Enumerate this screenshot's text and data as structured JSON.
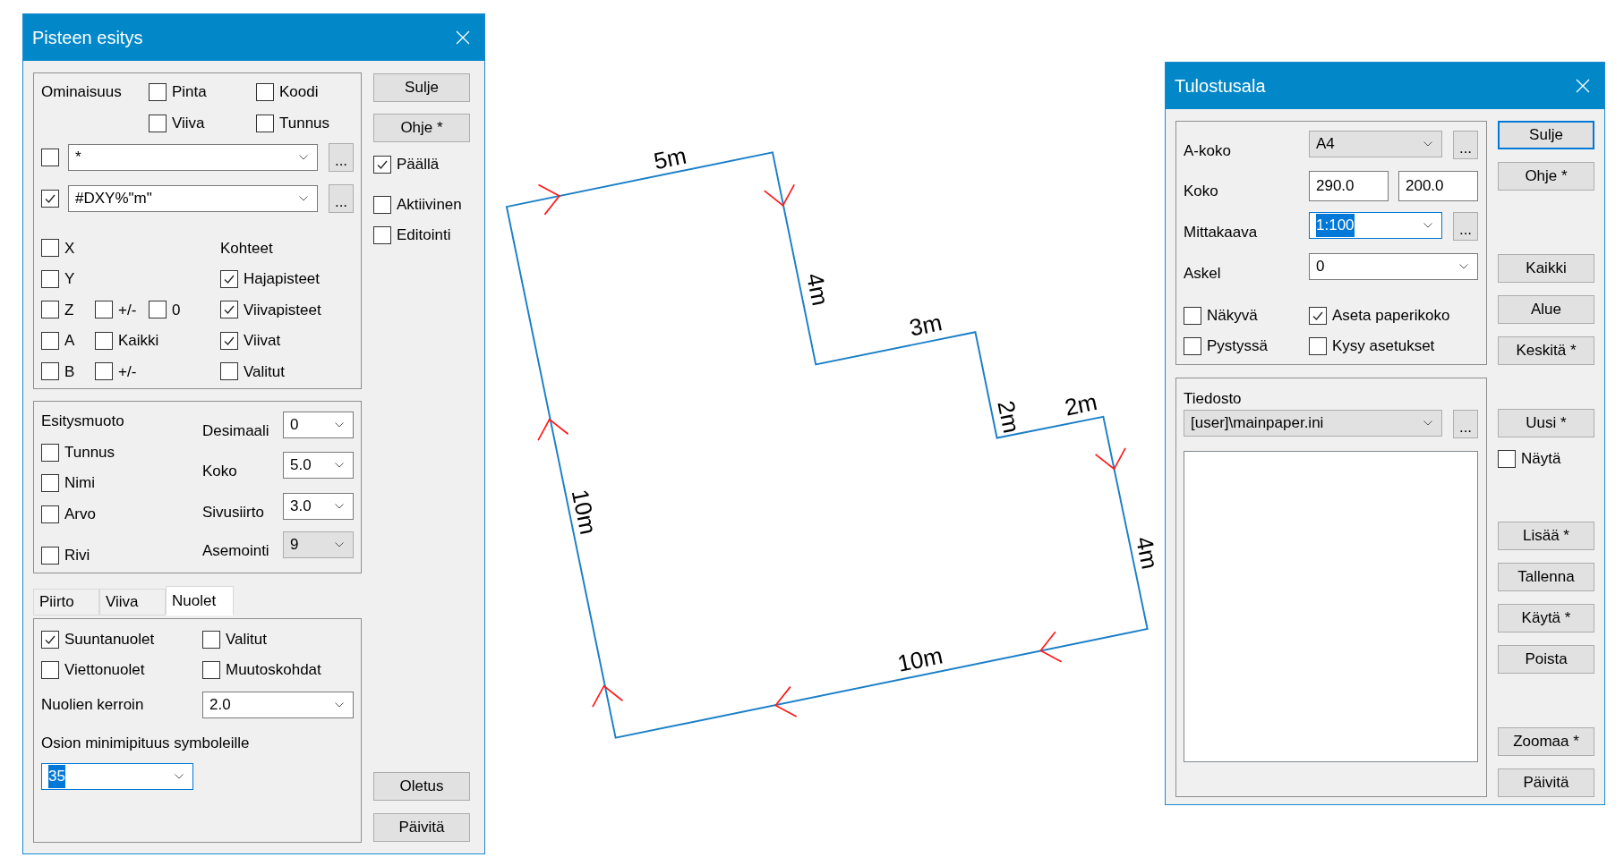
{
  "point_dialog": {
    "title": "Pisteen esitys",
    "properties_group": {
      "label": "Ominaisuus",
      "options": [
        {
          "label": "Pinta",
          "checked": false
        },
        {
          "label": "Koodi",
          "checked": false
        },
        {
          "label": "Viiva",
          "checked": false
        },
        {
          "label": "Tunnus",
          "checked": false
        }
      ],
      "filters": [
        {
          "checked": false,
          "value": "*",
          "browse": "..."
        },
        {
          "checked": true,
          "value": "#DXY%\"m\"",
          "browse": "..."
        }
      ],
      "coordinate_rows": [
        {
          "label": "X",
          "checked": false
        },
        {
          "label": "Y",
          "checked": false
        },
        {
          "label": "Z",
          "checked": false,
          "extras": [
            {
              "label": "+/-",
              "checked": false
            },
            {
              "label": "0",
              "checked": false
            }
          ]
        },
        {
          "label": "A",
          "checked": false,
          "extras": [
            {
              "label": "Kaikki",
              "checked": false
            }
          ]
        },
        {
          "label": "B",
          "checked": false,
          "extras": [
            {
              "label": "+/-",
              "checked": false
            }
          ]
        }
      ],
      "targets_label": "Kohteet",
      "targets": [
        {
          "label": "Hajapisteet",
          "checked": true
        },
        {
          "label": "Viivapisteet",
          "checked": true
        },
        {
          "label": "Viivat",
          "checked": true
        },
        {
          "label": "Valitut",
          "checked": false
        }
      ]
    },
    "format_group": {
      "label": "Esitysmuoto",
      "options": [
        {
          "label": "Tunnus",
          "checked": false
        },
        {
          "label": "Nimi",
          "checked": false
        },
        {
          "label": "Arvo",
          "checked": false
        },
        {
          "label": "Rivi",
          "checked": false
        }
      ],
      "fields": [
        {
          "label": "Desimaali",
          "value": "0",
          "disabled": false
        },
        {
          "label": "Koko",
          "value": "5.0",
          "disabled": false
        },
        {
          "label": "Sivusiirto",
          "value": "3.0",
          "disabled": false
        },
        {
          "label": "Asemointi",
          "value": "9",
          "disabled": true
        }
      ]
    },
    "tabs": [
      {
        "label": "Piirto",
        "selected": false
      },
      {
        "label": "Viiva",
        "selected": false
      },
      {
        "label": "Nuolet",
        "selected": true
      }
    ],
    "arrows_panel": {
      "options": [
        {
          "label": "Suuntanuolet",
          "checked": true
        },
        {
          "label": "Valitut",
          "checked": false
        },
        {
          "label": "Viettonuolet",
          "checked": false
        },
        {
          "label": "Muutoskohdat",
          "checked": false
        }
      ],
      "factor": {
        "label": "Nuolien kerroin",
        "value": "2.0",
        "text_selected": false
      },
      "min_length": {
        "label": "Osion minimipituus symboleille",
        "value": "35",
        "text_selected": true
      }
    },
    "side": [
      {
        "kind": "button",
        "label": "Sulje",
        "focused": false
      },
      {
        "kind": "button",
        "label": "Ohje *",
        "focused": false
      },
      {
        "kind": "checkbox",
        "label": "Päällä",
        "checked": true
      },
      {
        "kind": "checkbox",
        "label": "Aktiivinen",
        "checked": false
      },
      {
        "kind": "checkbox",
        "label": "Editointi",
        "checked": false
      },
      {
        "kind": "button",
        "label": "Oletus",
        "focused": false
      },
      {
        "kind": "button",
        "label": "Päivitä",
        "focused": false
      }
    ]
  },
  "drawing": {
    "edge_labels": [
      "5m",
      "4m",
      "3m",
      "2m",
      "2m",
      "4m",
      "10m",
      "10m"
    ]
  },
  "print_area_dialog": {
    "title": "Tulostusala",
    "fields": [
      {
        "kind": "combo",
        "label": "A-koko",
        "value": "A4",
        "disabled": true,
        "text_selected": false,
        "browse": "..."
      },
      {
        "kind": "pair",
        "label": "Koko",
        "values": [
          "290.0",
          "200.0"
        ]
      },
      {
        "kind": "combo",
        "label": "Mittakaava",
        "value": "1:100",
        "disabled": false,
        "text_selected": true,
        "browse": "..."
      },
      {
        "kind": "combo",
        "label": "Askel",
        "value": "0",
        "disabled": false,
        "text_selected": false
      }
    ],
    "options": [
      {
        "label": "Näkyvä",
        "checked": false
      },
      {
        "label": "Aseta paperikoko",
        "checked": true
      },
      {
        "label": "Pystyssä",
        "checked": false
      },
      {
        "label": "Kysy asetukset",
        "checked": false
      }
    ],
    "file_group": {
      "label": "Tiedosto",
      "value": "[user]\\mainpaper.ini",
      "disabled": true,
      "browse": "..."
    },
    "side": [
      {
        "kind": "button",
        "label": "Sulje",
        "focused": true
      },
      {
        "kind": "button",
        "label": "Ohje *",
        "focused": false
      },
      {
        "kind": "button",
        "label": "Kaikki",
        "focused": false
      },
      {
        "kind": "button",
        "label": "Alue",
        "focused": false
      },
      {
        "kind": "button",
        "label": "Keskitä *",
        "focused": false
      },
      {
        "kind": "button",
        "label": "Uusi *",
        "focused": false
      },
      {
        "kind": "checkbox",
        "label": "Näytä",
        "checked": false
      },
      {
        "kind": "button",
        "label": "Lisää *",
        "focused": false
      },
      {
        "kind": "button",
        "label": "Tallenna",
        "focused": false
      },
      {
        "kind": "button",
        "label": "Käytä *",
        "focused": false
      },
      {
        "kind": "button",
        "label": "Poista",
        "focused": false
      },
      {
        "kind": "button",
        "label": "Zoomaa *",
        "focused": false
      },
      {
        "kind": "button",
        "label": "Päivitä",
        "focused": false
      }
    ]
  }
}
